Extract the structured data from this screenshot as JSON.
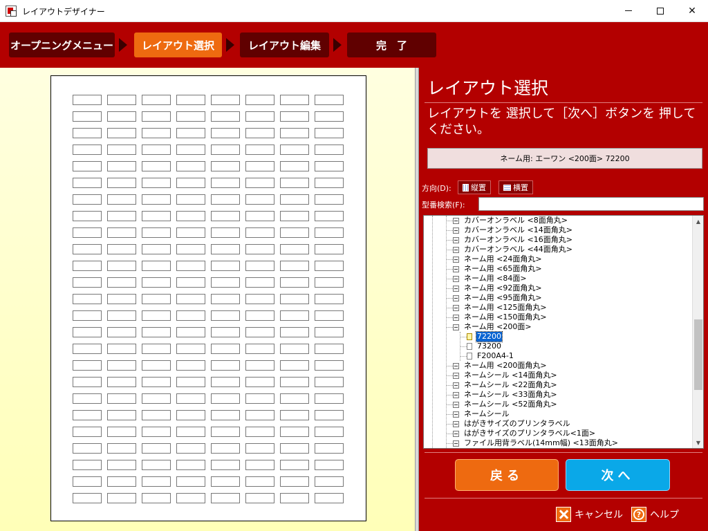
{
  "window": {
    "title": "レイアウトデザイナー",
    "close_glyph": "✕"
  },
  "steps": [
    {
      "label": "オープニングメニュー",
      "active": false
    },
    {
      "label": "レイアウト選択",
      "active": true
    },
    {
      "label": "レイアウト編集",
      "active": false
    },
    {
      "label": "完　了",
      "active": false
    }
  ],
  "preview": {
    "label_columns": 8,
    "label_rows": 25
  },
  "panel": {
    "title": "レイアウト選択",
    "description": "レイアウトを 選択して［次へ］ボタンを 押してください。",
    "selected_layout": "ネーム用: エーワン <200面> 72200",
    "direction_label": "方向(D):",
    "portrait_label": "縦置",
    "landscape_label": "横置",
    "search_label": "型番検索(F):",
    "search_value": ""
  },
  "tree": {
    "items": [
      {
        "label": "カバーオンラベル <8面角丸>",
        "level": 1,
        "type": "node"
      },
      {
        "label": "カバーオンラベル <14面角丸>",
        "level": 1,
        "type": "node"
      },
      {
        "label": "カバーオンラベル <16面角丸>",
        "level": 1,
        "type": "node"
      },
      {
        "label": "カバーオンラベル <44面角丸>",
        "level": 1,
        "type": "node"
      },
      {
        "label": "ネーム用 <24面角丸>",
        "level": 1,
        "type": "node"
      },
      {
        "label": "ネーム用 <65面角丸>",
        "level": 1,
        "type": "node"
      },
      {
        "label": "ネーム用 <84面>",
        "level": 1,
        "type": "node"
      },
      {
        "label": "ネーム用 <92面角丸>",
        "level": 1,
        "type": "node"
      },
      {
        "label": "ネーム用 <95面角丸>",
        "level": 1,
        "type": "node"
      },
      {
        "label": "ネーム用 <125面角丸>",
        "level": 1,
        "type": "node"
      },
      {
        "label": "ネーム用 <150面角丸>",
        "level": 1,
        "type": "node"
      },
      {
        "label": "ネーム用 <200面>",
        "level": 1,
        "type": "node"
      },
      {
        "label": "72200",
        "level": 2,
        "type": "file",
        "selected": true
      },
      {
        "label": "73200",
        "level": 2,
        "type": "file"
      },
      {
        "label": "F200A4-1",
        "level": 2,
        "type": "file"
      },
      {
        "label": "ネーム用 <200面角丸>",
        "level": 1,
        "type": "node"
      },
      {
        "label": "ネームシール <14面角丸>",
        "level": 1,
        "type": "node"
      },
      {
        "label": "ネームシール <22面角丸>",
        "level": 1,
        "type": "node"
      },
      {
        "label": "ネームシール <33面角丸>",
        "level": 1,
        "type": "node"
      },
      {
        "label": "ネームシール <52面角丸>",
        "level": 1,
        "type": "node"
      },
      {
        "label": "ネームシール",
        "level": 1,
        "type": "node"
      },
      {
        "label": "はがきサイズのプリンタラベル",
        "level": 1,
        "type": "node"
      },
      {
        "label": "はがきサイズのプリンタラベル<1面>",
        "level": 1,
        "type": "node"
      },
      {
        "label": "ファイル用背ラベル(14mm幅) <13面角丸>",
        "level": 1,
        "type": "node"
      }
    ],
    "scroll_position": 0.53
  },
  "buttons": {
    "back": "戻る",
    "next": "次へ",
    "cancel": "キャンセル",
    "help": "ヘルプ",
    "help_glyph": "?"
  },
  "colors": {
    "background": "#b30000",
    "active_step": "#ee6a10",
    "next_button": "#0aa8e8",
    "selection": "#0a64d2"
  }
}
